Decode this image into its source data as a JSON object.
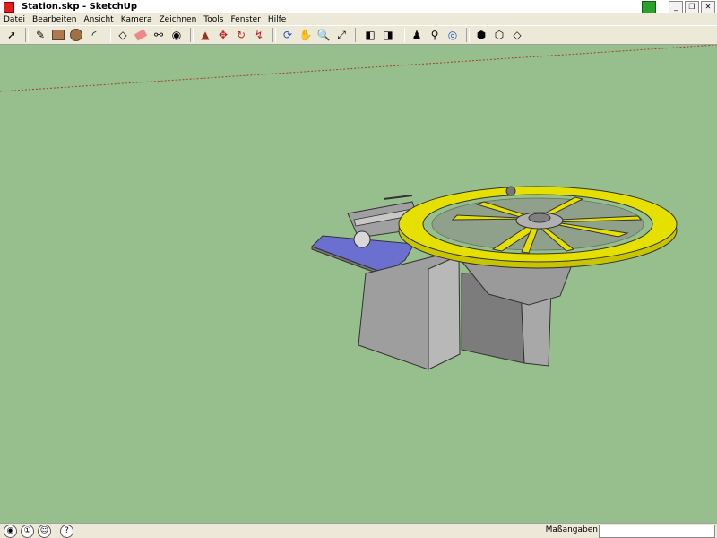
{
  "window": {
    "title": "Station.skp - SketchUp"
  },
  "menu": [
    "Datei",
    "Bearbeiten",
    "Ansicht",
    "Kamera",
    "Zeichnen",
    "Tools",
    "Fenster",
    "Hilfe"
  ],
  "toolbar": {
    "groups": [
      [
        "select-tool",
        "pencil-tool",
        "rectangle-tool",
        "circle-tool",
        "arc-tool"
      ],
      [
        "make-component-tool",
        "eraser-tool",
        "tape-measure-tool",
        "paint-bucket-tool"
      ],
      [
        "push-pull-tool",
        "move-tool",
        "rotate-tool",
        "follow-me-tool"
      ],
      [
        "orbit-tool",
        "pan-tool",
        "zoom-tool",
        "zoom-extents-tool"
      ],
      [
        "previous-view-tool",
        "next-view-tool"
      ],
      [
        "position-camera-tool",
        "walk-tool",
        "look-around-tool"
      ],
      [
        "get-models-tool",
        "share-model-tool",
        "share-component-tool"
      ]
    ]
  },
  "status": {
    "measurements_label": "Maßangaben",
    "measurements_value": ""
  },
  "colors": {
    "viewport_bg": "#96bf8d",
    "wheel": "#e5e000"
  }
}
